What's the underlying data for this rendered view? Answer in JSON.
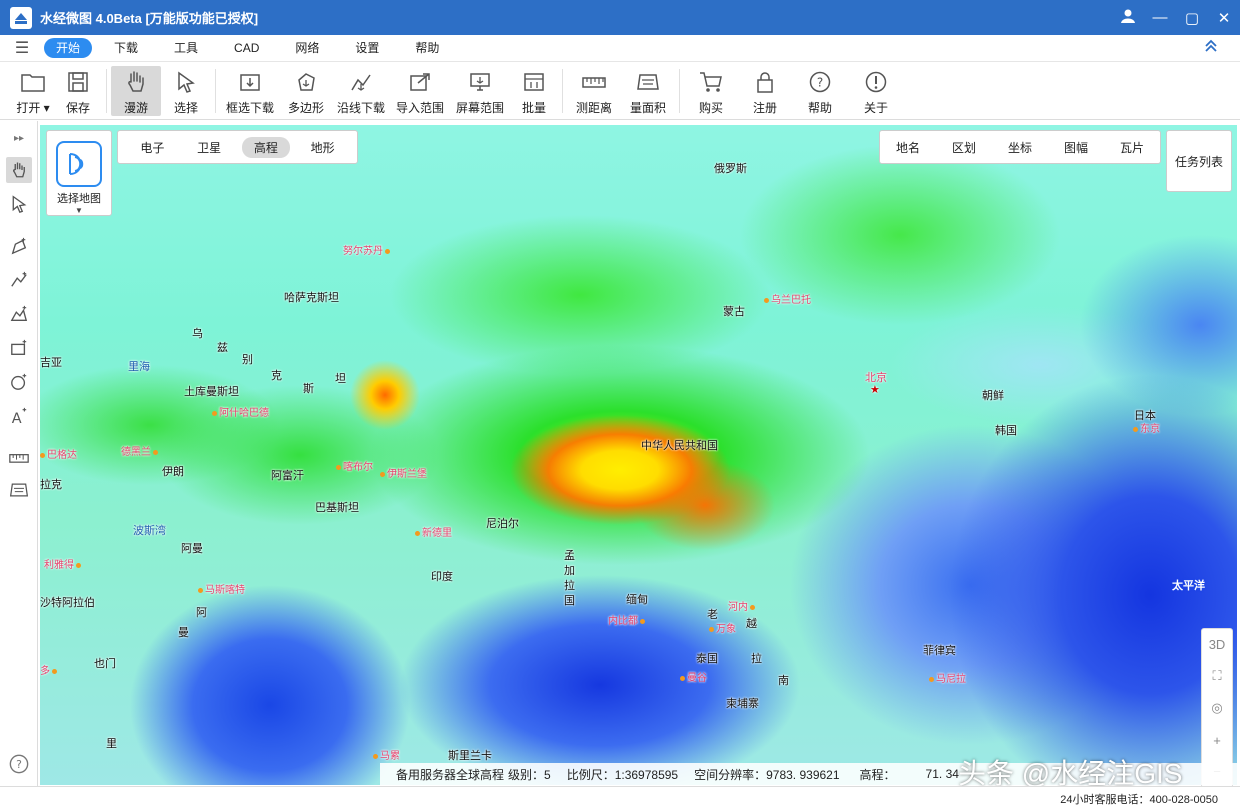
{
  "window": {
    "title": "水经微图 4.0Beta [万能版功能已授权]",
    "controls": {
      "user": "user-icon",
      "minimize": "—",
      "maximize": "▢",
      "close": "✕"
    }
  },
  "menu": {
    "items": [
      "开始",
      "下载",
      "工具",
      "CAD",
      "网络",
      "设置",
      "帮助"
    ],
    "active": "开始"
  },
  "toolbar": {
    "open": "打开",
    "save": "保存",
    "pan": "漫游",
    "select": "选择",
    "box_download": "框选下载",
    "polygon": "多边形",
    "line_download": "沿线下载",
    "import_range": "导入范围",
    "screen_range": "屏幕范围",
    "batch": "批量",
    "measure_distance": "测距离",
    "measure_area": "量面积",
    "buy": "购买",
    "register": "注册",
    "help": "帮助",
    "about": "关于"
  },
  "map_selector": {
    "label": "选择地图"
  },
  "map_types": [
    "电子",
    "卫星",
    "高程",
    "地形"
  ],
  "map_type_active": "高程",
  "layers": [
    "地名",
    "区划",
    "坐标",
    "图幅",
    "瓦片"
  ],
  "task_list": "任务列表",
  "zoom_controls": {
    "three_d": "3D",
    "fullscreen": "⛶",
    "locate": "◎",
    "zoom_in": "+",
    "zoom_out": "−"
  },
  "map_labels": {
    "countries": [
      "俄罗斯",
      "哈萨克斯坦",
      "蒙古",
      "中华人民共和国",
      "朝鲜",
      "韩国",
      "日本",
      "土库曼斯坦",
      "伊朗",
      "阿富汗",
      "巴基斯坦",
      "尼泊尔",
      "印度",
      "孟加拉国",
      "缅甸",
      "老",
      "越",
      "泰国",
      "柬埔寨",
      "菲律宾",
      "阿曼",
      "也门",
      "拉克",
      "沙特阿拉伯",
      "斯里兰卡",
      "南",
      "拉",
      "里"
    ],
    "uzbek_chars": [
      "乌",
      "兹",
      "别",
      "克",
      "斯",
      "坦"
    ],
    "arabia_chars": [
      "阿",
      "曼"
    ],
    "fragments": [
      "吉亚"
    ],
    "cities": [
      "努尔苏丹",
      "乌兰巴托",
      "北京",
      "阿什哈巴德",
      "德黑兰",
      "喀布尔",
      "伊斯兰堡",
      "新德里",
      "巴格达",
      "利雅得",
      "马斯喀特",
      "内比都",
      "河内",
      "万象",
      "曼谷",
      "马尼拉",
      "东京",
      "马累",
      "多"
    ],
    "seas": [
      "里海",
      "波斯湾"
    ],
    "ocean": "太平洋"
  },
  "map_status": {
    "source": "备用服务器全球高程",
    "level": "级别：5",
    "scale": "比例尺：1:36978595",
    "resolution": "空间分辨率：9783. 939621",
    "elevation": "高程：",
    "elevation_value": "71. 34"
  },
  "watermark": "头条 @水经注GIS",
  "status_bar": {
    "support": "24小时客服电话：400-028-0050"
  },
  "colors": {
    "title_bar": "#2d6fc6",
    "accent": "#2d8cf0",
    "city_label": "#e8436e"
  }
}
